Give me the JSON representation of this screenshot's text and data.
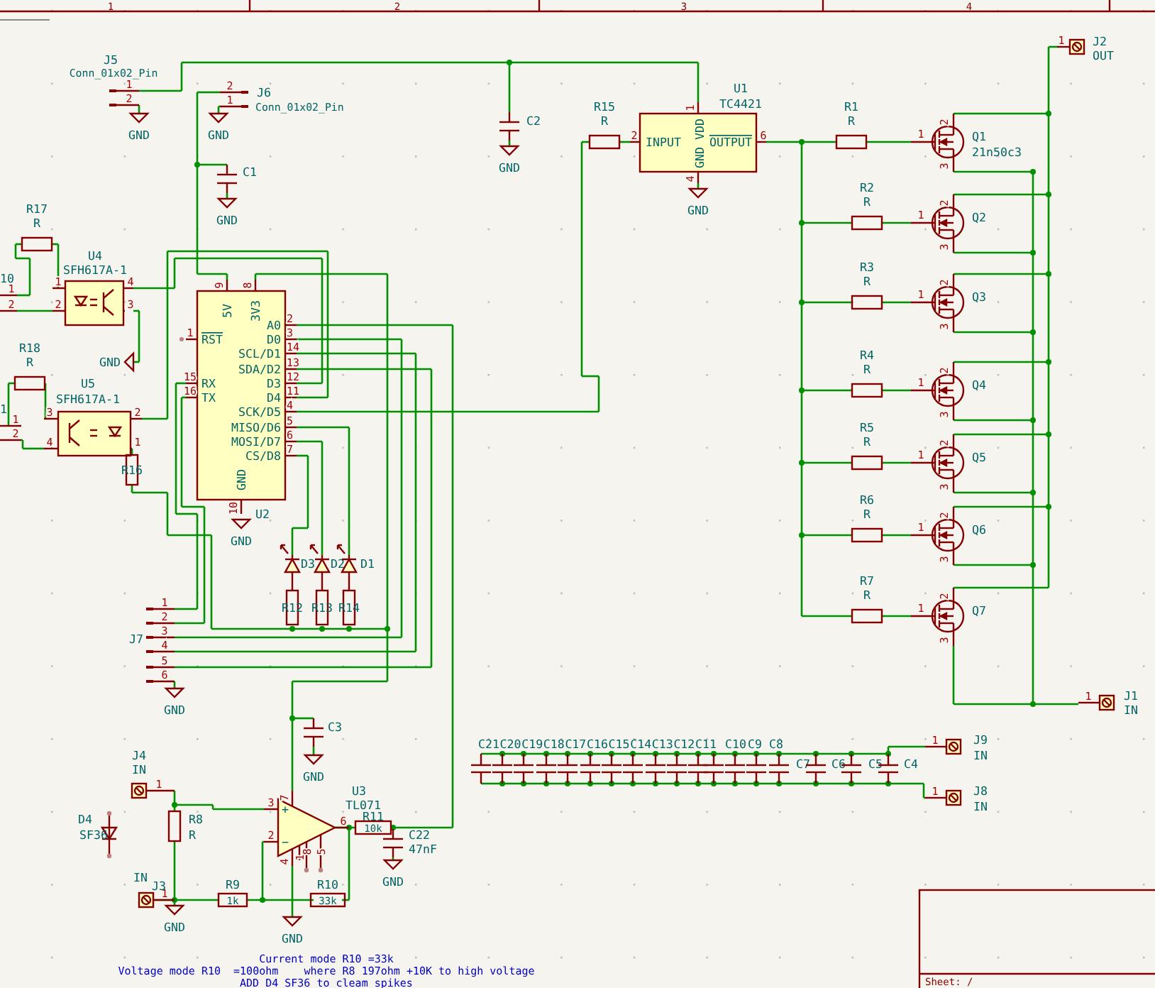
{
  "frame": {
    "column_numbers": [
      "1",
      "2",
      "3",
      "4"
    ],
    "title_block": "Sheet: /"
  },
  "symbols": [
    {
      "kind": "pin_header",
      "ref": "J5",
      "value": "Conn_01x02_Pin",
      "pins": [
        "1",
        "2"
      ]
    },
    {
      "kind": "pin_header",
      "ref": "J6",
      "value": "Conn_01x02_Pin",
      "pins": [
        "2",
        "1"
      ]
    },
    {
      "kind": "capacitor",
      "ref": "C1"
    },
    {
      "kind": "capacitor",
      "ref": "C2"
    },
    {
      "kind": "resistor",
      "ref": "R15",
      "value": "R"
    },
    {
      "kind": "driver_ic",
      "ref": "U1",
      "value": "TC4421",
      "pins": [
        {
          "number": "1",
          "name": "VDD",
          "inverted": false
        },
        {
          "number": "2",
          "name": "INPUT",
          "inverted": false
        },
        {
          "number": "6",
          "name": "OUTPUT",
          "inverted": true
        },
        {
          "number": "4",
          "name": "GND",
          "inverted": false
        }
      ]
    },
    {
      "kind": "resistor",
      "ref": "R1",
      "value": "R"
    },
    {
      "kind": "mosfet",
      "ref": "Q1",
      "value": "21n50c3",
      "pins": [
        "1",
        "2",
        "3"
      ]
    },
    {
      "kind": "terminal",
      "ref": "J2",
      "value": "OUT",
      "pins": [
        "1"
      ]
    },
    {
      "kind": "edge_connector",
      "ref": "10",
      "pins": [
        "1",
        "2"
      ]
    },
    {
      "kind": "resistor",
      "ref": "R17",
      "value": "R"
    },
    {
      "kind": "optocoupler",
      "ref": "U4",
      "value": "SFH617A-1",
      "pins": [
        "1",
        "2",
        "4",
        "3"
      ]
    },
    {
      "kind": "mcu_module",
      "ref": "U2",
      "pins": [
        {
          "number": "9",
          "name": "5V",
          "inverted": false
        },
        {
          "number": "8",
          "name": "3V3",
          "inverted": false
        },
        {
          "number": "1",
          "name": "RST",
          "inverted": true
        },
        {
          "number": "15",
          "name": "RX",
          "inverted": false
        },
        {
          "number": "16",
          "name": "TX",
          "inverted": false
        },
        {
          "number": "2",
          "name": "A0",
          "inverted": false
        },
        {
          "number": "3",
          "name": "D0",
          "inverted": false
        },
        {
          "number": "14",
          "name": "SCL/D1",
          "inverted": false
        },
        {
          "number": "13",
          "name": "SDA/D2",
          "inverted": false
        },
        {
          "number": "12",
          "name": "D3",
          "inverted": false
        },
        {
          "number": "11",
          "name": "D4",
          "inverted": false
        },
        {
          "number": "4",
          "name": "SCK/D5",
          "inverted": false
        },
        {
          "number": "5",
          "name": "MISO/D6",
          "inverted": false
        },
        {
          "number": "6",
          "name": "MOSI/D7",
          "inverted": false
        },
        {
          "number": "7",
          "name": "CS/D8",
          "inverted": false
        },
        {
          "number": "10",
          "name": "GND",
          "inverted": false
        }
      ]
    },
    {
      "kind": "resistor",
      "ref": "R2",
      "value": "R"
    },
    {
      "kind": "mosfet",
      "ref": "Q2",
      "pins": [
        "1",
        "2",
        "3"
      ]
    },
    {
      "kind": "resistor",
      "ref": "R3",
      "value": "R"
    },
    {
      "kind": "mosfet",
      "ref": "Q3",
      "pins": [
        "1",
        "2",
        "3"
      ]
    },
    {
      "kind": "edge_connector",
      "ref": "1",
      "pins": [
        "1",
        "2"
      ]
    },
    {
      "kind": "resistor",
      "ref": "R18",
      "value": "R"
    },
    {
      "kind": "optocoupler",
      "ref": "U5",
      "value": "SFH617A-1",
      "pins": [
        "3",
        "4",
        "2",
        "1"
      ]
    },
    {
      "kind": "resistor",
      "ref": "R4",
      "value": "R"
    },
    {
      "kind": "mosfet",
      "ref": "Q4",
      "pins": [
        "1",
        "2",
        "3"
      ]
    },
    {
      "kind": "resistor",
      "ref": "R16"
    },
    {
      "kind": "resistor",
      "ref": "R5",
      "value": "R"
    },
    {
      "kind": "mosfet",
      "ref": "Q5",
      "pins": [
        "1",
        "2",
        "3"
      ]
    },
    {
      "kind": "resistor",
      "ref": "R6",
      "value": "R"
    },
    {
      "kind": "mosfet",
      "ref": "Q6",
      "pins": [
        "1",
        "2",
        "3"
      ]
    },
    {
      "kind": "led",
      "ref": "D3"
    },
    {
      "kind": "led",
      "ref": "D2"
    },
    {
      "kind": "led",
      "ref": "D1"
    },
    {
      "kind": "resistor",
      "ref": "R12"
    },
    {
      "kind": "resistor",
      "ref": "R13"
    },
    {
      "kind": "resistor",
      "ref": "R14"
    },
    {
      "kind": "resistor",
      "ref": "R7",
      "value": "R"
    },
    {
      "kind": "mosfet",
      "ref": "Q7",
      "pins": [
        "1",
        "2",
        "3"
      ]
    },
    {
      "kind": "pin_header",
      "ref": "J7",
      "pins": [
        "1",
        "2",
        "3",
        "4",
        "5",
        "6"
      ]
    },
    {
      "kind": "terminal",
      "ref": "J1",
      "value": "IN",
      "pins": [
        "1"
      ]
    },
    {
      "kind": "capacitor",
      "ref": "C3"
    },
    {
      "kind": "terminal",
      "ref": "J4",
      "value": "IN",
      "pins": [
        "1"
      ]
    },
    {
      "kind": "opamp",
      "ref": "U3",
      "value": "TL071",
      "pins": [
        {
          "number": "3",
          "name": "+"
        },
        {
          "number": "2",
          "name": "−"
        },
        {
          "number": "7"
        },
        {
          "number": "4"
        },
        {
          "number": "6"
        },
        {
          "number": "1"
        },
        {
          "number": "8"
        },
        {
          "number": "5"
        }
      ]
    },
    {
      "kind": "resistor",
      "ref": "R11",
      "value": "10k"
    },
    {
      "kind": "capacitor",
      "ref": "C22",
      "value": "47nF"
    },
    {
      "kind": "diode",
      "ref": "D4",
      "value": "SF36"
    },
    {
      "kind": "resistor",
      "ref": "R8",
      "value": "R"
    },
    {
      "kind": "terminal",
      "ref": "J3",
      "value": "IN",
      "pins": [
        "1"
      ]
    },
    {
      "kind": "resistor",
      "ref": "R9",
      "value": "1k"
    },
    {
      "kind": "resistor",
      "ref": "R10",
      "value": "33k"
    },
    {
      "kind": "terminal",
      "ref": "J9",
      "value": "IN",
      "pins": [
        "1"
      ]
    },
    {
      "kind": "terminal",
      "ref": "J8",
      "value": "IN",
      "pins": [
        "1"
      ]
    }
  ],
  "capacitor_bank": [
    {
      "ref": "C21"
    },
    {
      "ref": "C20"
    },
    {
      "ref": "C19"
    },
    {
      "ref": "C18"
    },
    {
      "ref": "C17"
    },
    {
      "ref": "C16"
    },
    {
      "ref": "C15"
    },
    {
      "ref": "C14"
    },
    {
      "ref": "C13"
    },
    {
      "ref": "C12"
    },
    {
      "ref": "C11"
    },
    {
      "ref": "C10"
    },
    {
      "ref": "C9"
    },
    {
      "ref": "C8"
    },
    {
      "ref": "C7"
    },
    {
      "ref": "C6"
    },
    {
      "ref": "C5"
    },
    {
      "ref": "C4"
    }
  ],
  "ground_symbols": [
    {
      "label": "GND"
    },
    {
      "label": "GND"
    },
    {
      "label": "GND"
    },
    {
      "label": "GND"
    },
    {
      "label": "GND"
    },
    {
      "label": "GND"
    },
    {
      "label": "GND"
    },
    {
      "label": "GND"
    },
    {
      "label": "GND"
    },
    {
      "label": "GND"
    },
    {
      "label": "GND"
    },
    {
      "label": "GND"
    }
  ],
  "notes": [
    "Current mode R10 =33k",
    "Voltage mode R10  =100ohm    where R8 197ohm +10K to high voltage",
    "ADD D4 SF36 to cleam spikes"
  ]
}
